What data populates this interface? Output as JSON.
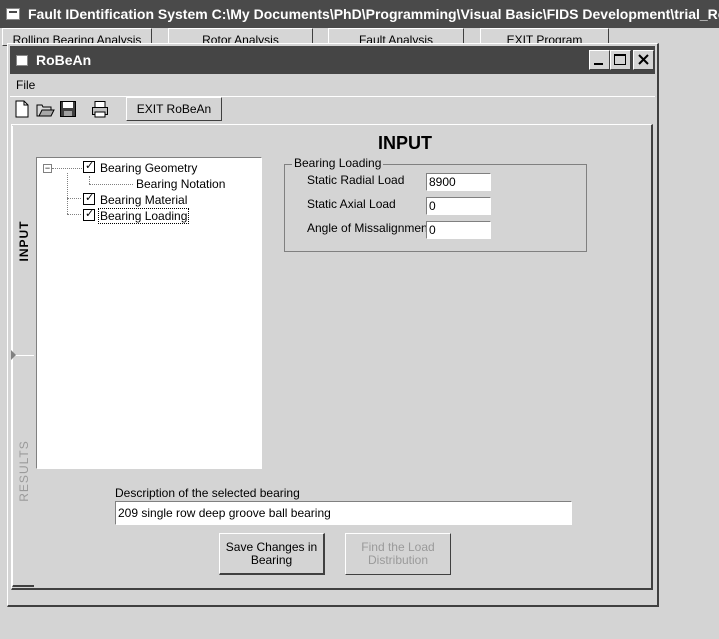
{
  "parent": {
    "title": "Fault IDentification System   C:\\My Documents\\PhD\\Programming\\Visual Basic\\FIDS Development\\trial_Robean.rb",
    "buttons": [
      "Rolling Bearing Analysis",
      "Rotor Analysis",
      "Fault Analysis",
      "EXIT Program"
    ]
  },
  "window": {
    "title": "RoBeAn"
  },
  "menu": {
    "file": "File"
  },
  "toolbar": {
    "exit_label": "EXIT RoBeAn"
  },
  "tabs": {
    "input": "INPUT",
    "results": "RESULTS"
  },
  "page_heading": "INPUT",
  "tree": {
    "geometry": "Bearing Geometry",
    "notation": "Bearing Notation",
    "material": "Bearing Material",
    "loading": "Bearing Loading"
  },
  "loading_group": {
    "caption": "Bearing Loading",
    "radial_label": "Static Radial Load",
    "radial_value": "8900",
    "axial_label": "Static Axial Load",
    "axial_value": "0",
    "angle_label": "Angle of Missalignment",
    "angle_value": "0"
  },
  "description": {
    "label": "Description of the selected bearing",
    "value": "209 single row deep groove ball bearing"
  },
  "buttons": {
    "save_line1": "Save Changes in",
    "save_line2": "Bearing",
    "find_line1": "Find the Load",
    "find_line2": "Distribution"
  }
}
